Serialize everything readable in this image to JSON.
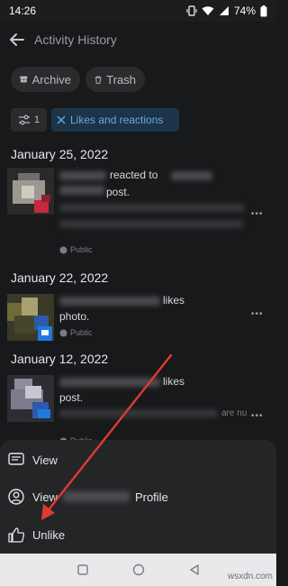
{
  "status_bar": {
    "time": "14:26",
    "battery": "74%"
  },
  "header": {
    "title": "Activity History"
  },
  "chips": {
    "archive": "Archive",
    "trash": "Trash"
  },
  "filter": {
    "count": "1",
    "active_label": "Likes and reactions"
  },
  "activities": [
    {
      "date": "January 25, 2022",
      "action": "reacted to",
      "second_line": "post.",
      "privacy": "Public"
    },
    {
      "date": "January 22, 2022",
      "action": "likes",
      "second_line": "photo.",
      "privacy": "Public"
    },
    {
      "date": "January 12, 2022",
      "action": "likes",
      "second_line": "post.",
      "trailing_text": "are nu",
      "privacy": "Public"
    }
  ],
  "sheet": {
    "view": "View",
    "view_profile_prefix": "View",
    "view_profile_suffix": "Profile",
    "unlike": "Unlike"
  },
  "watermark": "wsxdn.com",
  "colors": {
    "background": "#18191a",
    "accent_blue": "#6aa7e0",
    "annotation_arrow": "#e03a2e"
  },
  "icons": [
    "back-arrow-icon",
    "archive-icon",
    "trash-icon",
    "sliders-icon",
    "close-icon",
    "globe-icon",
    "more-icon",
    "message-icon",
    "user-icon",
    "thumbs-up-icon"
  ]
}
